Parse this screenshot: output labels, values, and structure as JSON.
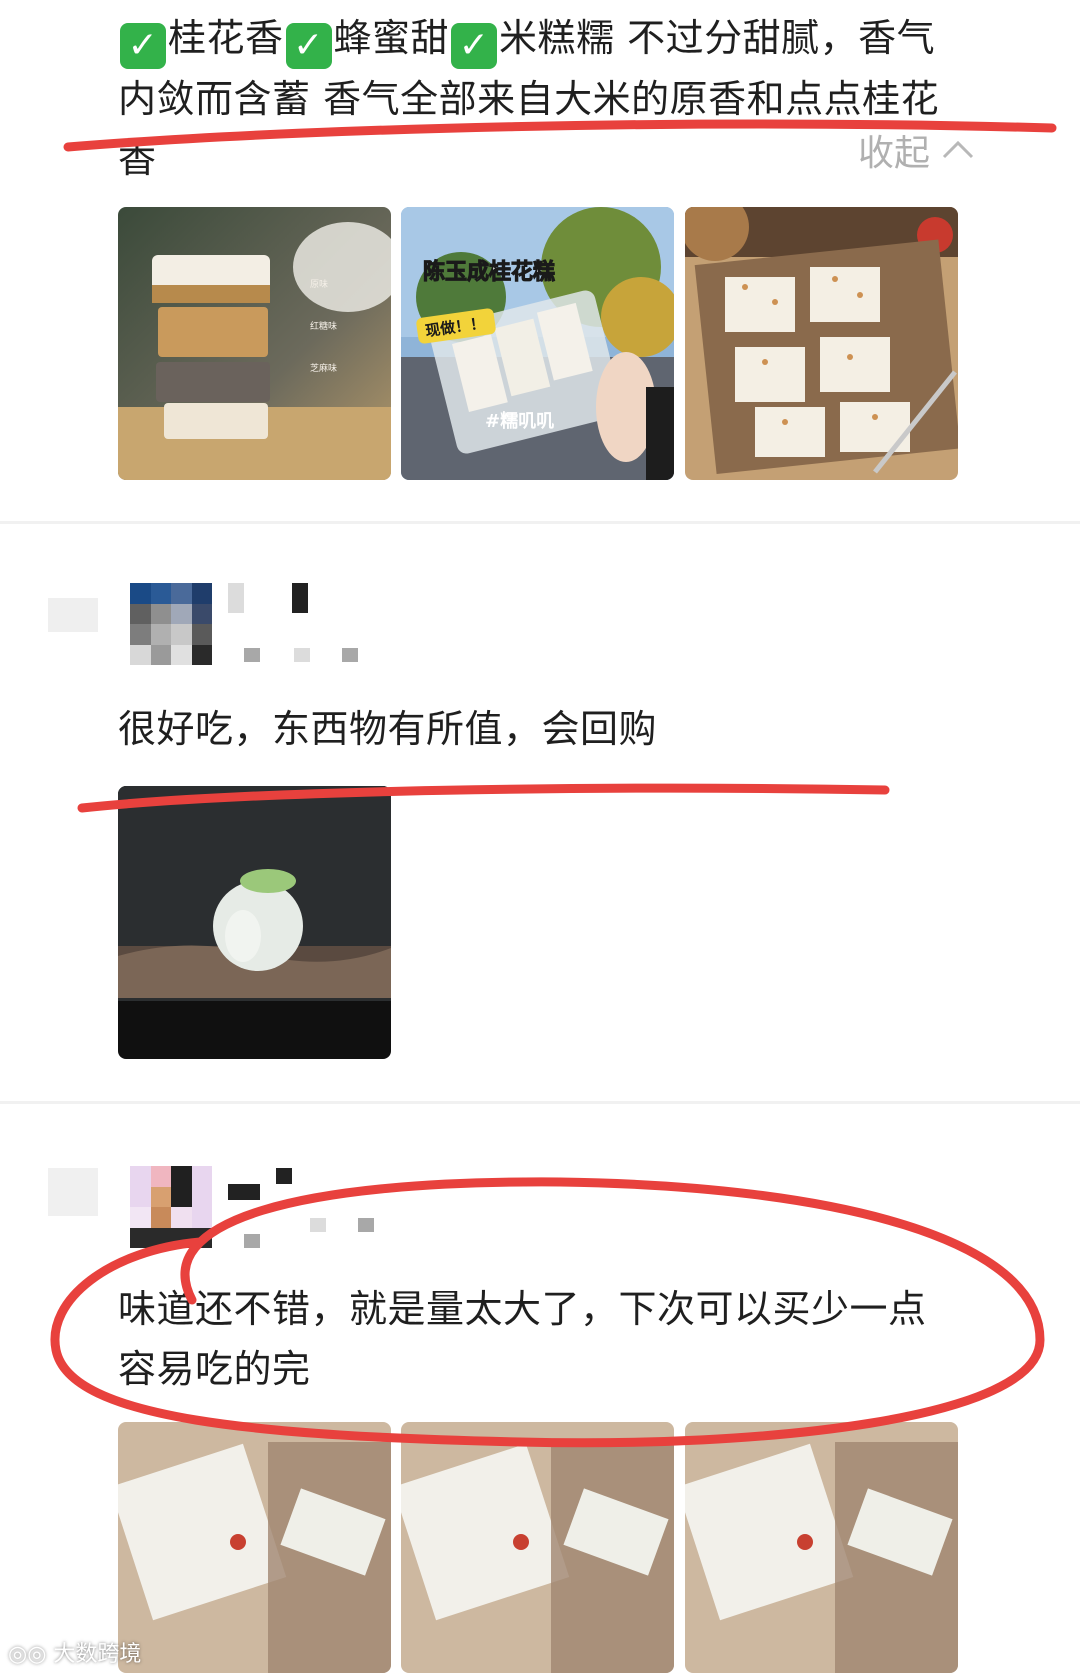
{
  "review1": {
    "line1": "桂花香 蜂蜜甜 米糕糯 不过分甜腻，香气",
    "line1_parts": [
      "桂花香",
      "蜂蜜甜",
      "米糕糯 不过分甜腻，香气"
    ],
    "line2": "内敛而含蓄 香气全部来自大米的原香和点点桂花",
    "line3": "香",
    "collapse_label": "收起",
    "images": [
      {
        "name": "layered-cakes",
        "labels": [
          "原味",
          "红糖味",
          "芝麻味"
        ]
      },
      {
        "name": "packaged-cake",
        "title": "陈玉成桂花糕",
        "badge": "现做！！",
        "tag": "#糯叽叽"
      },
      {
        "name": "osmanthus-cake-tray"
      }
    ]
  },
  "review2": {
    "text": "很好吃，东西物有所值，会回购"
  },
  "review3": {
    "line1": "味道还不错，就是量太大了，下次可以买少一点",
    "line2": "容易吃的完"
  },
  "watermark": "大数跨境",
  "icons": {
    "check": "check-box-icon",
    "collapse": "chevron-up-icon"
  },
  "colors": {
    "annotation": "#e8413d",
    "check_green": "#33b24a"
  }
}
